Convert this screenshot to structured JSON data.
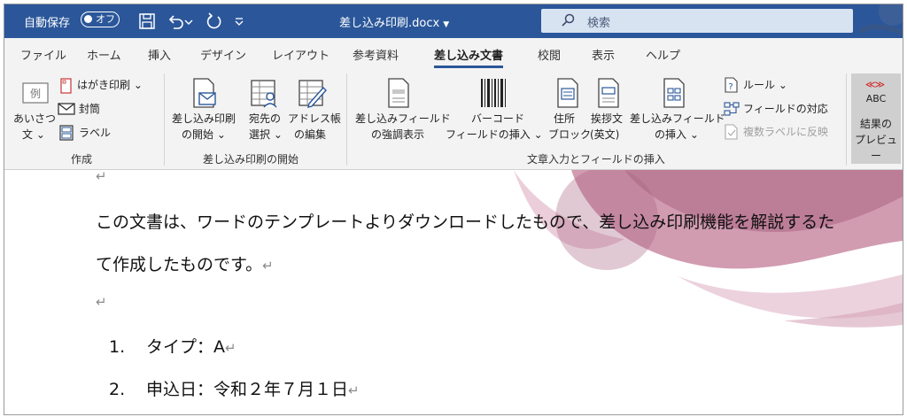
{
  "titlebar": {
    "autosave_label": "自動保存",
    "autosave_state": "オフ",
    "doc_title": "差し込み印刷.docx",
    "search_placeholder": "検索"
  },
  "tabs": [
    {
      "label": "ファイル"
    },
    {
      "label": "ホーム"
    },
    {
      "label": "挿入"
    },
    {
      "label": "デザイン"
    },
    {
      "label": "レイアウト"
    },
    {
      "label": "参考資料"
    },
    {
      "label": "差し込み文書",
      "active": true
    },
    {
      "label": "校閲"
    },
    {
      "label": "表示"
    },
    {
      "label": "ヘルプ"
    }
  ],
  "ribbon": {
    "create": {
      "group": "作成",
      "greeting_line1": "あいさつ",
      "greeting_line2": "文 ⌄",
      "postcard": "はがき印刷 ⌄",
      "envelope": "封筒",
      "label": "ラベル",
      "sample_icon_text": "例"
    },
    "merge_start": {
      "group": "差し込み印刷の開始",
      "start_line1": "差し込み印刷",
      "start_line2": "の開始 ⌄",
      "recipients_line1": "宛先の",
      "recipients_line2": "選択 ⌄",
      "edit_line1": "アドレス帳",
      "edit_line2": "の編集"
    },
    "fields": {
      "group": "文章入力とフィールドの挿入",
      "highlight_line1": "差し込みフィールド",
      "highlight_line2": "の強調表示",
      "barcode_line1": "バーコード",
      "barcode_line2": "フィールドの挿入 ⌄",
      "address_line1": "住所",
      "address_line2": "ブロック",
      "greeting_line1": "挨拶文",
      "greeting_line2": "(英文)",
      "insert_line1": "差し込みフィールド",
      "insert_line2": "の挿入 ⌄",
      "rules": "ルール ⌄",
      "match": "フィールドの対応",
      "update": "複数ラベルに反映"
    },
    "preview": {
      "icon_text": "ABC",
      "line1": "結果の",
      "line2": "プレビュー"
    }
  },
  "document": {
    "para1": "この文書は、ワードのテンプレートよりダウンロードしたもので、差し込み印刷機能を解説するた",
    "para2": "て作成したものです。",
    "items": [
      {
        "num": "1.",
        "text": "タイプ：A"
      },
      {
        "num": "2.",
        "text": "申込日：令和２年７月１日"
      }
    ],
    "return_mark": "↵"
  },
  "colors": {
    "title_bar": "#2b579a",
    "ribbon_bg": "#f3f3f3",
    "search_bg": "#d8e3f2",
    "tab_underline": "#2b579a",
    "preview_button": "#cfcfcf",
    "deco_pink": "#c98aa2"
  }
}
